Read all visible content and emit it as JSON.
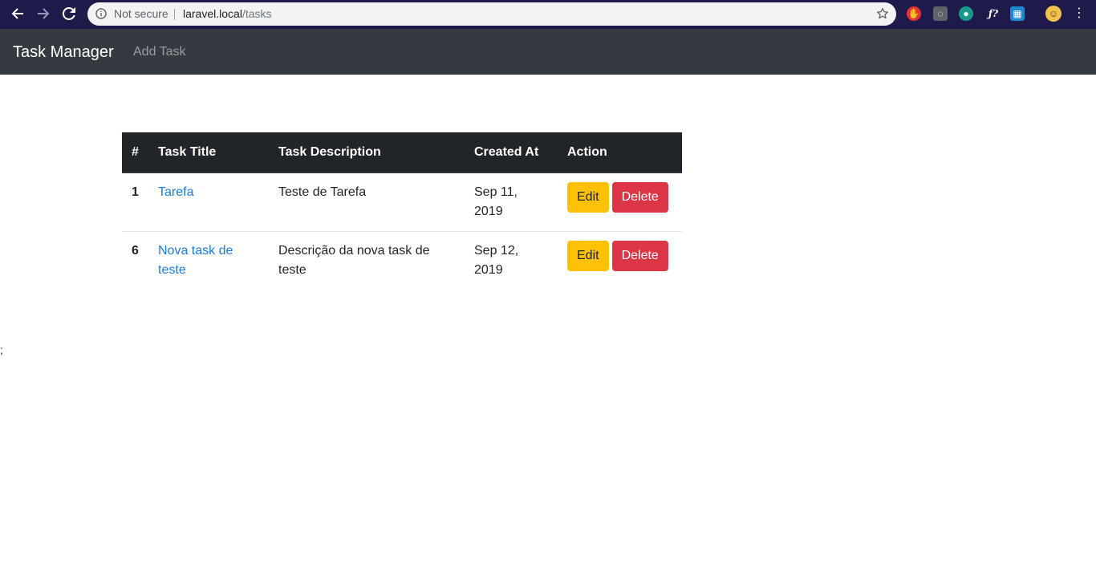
{
  "browser": {
    "security_label": "Not secure",
    "url_host": "laravel.local",
    "url_path": "/tasks",
    "extensions": [
      {
        "name": "adblock-extension-icon",
        "color": "#e8313a",
        "glyph": "✋"
      },
      {
        "name": "lightbulb-extension-icon",
        "color": "#5f6368",
        "glyph": "◌"
      },
      {
        "name": "palette-extension-icon",
        "color": "#1a9b8a",
        "glyph": "●"
      },
      {
        "name": "function-extension-icon",
        "color": "#1e1a4a",
        "glyph": "ƒ?"
      },
      {
        "name": "trello-extension-icon",
        "color": "#1f86d1",
        "glyph": "▦"
      },
      {
        "name": "profile-avatar-icon",
        "color": "#f2c14e",
        "glyph": "☺"
      }
    ]
  },
  "navbar": {
    "brand": "Task Manager",
    "add_task": "Add Task"
  },
  "table": {
    "headers": {
      "id": "#",
      "title": "Task Title",
      "description": "Task Description",
      "created_at": "Created At",
      "action": "Action"
    },
    "rows": [
      {
        "id": "1",
        "title": "Tarefa",
        "description": "Teste de Tarefa",
        "created_at": "Sep 11, 2019",
        "edit": "Edit",
        "delete": "Delete"
      },
      {
        "id": "6",
        "title": "Nova task de teste",
        "description": "Descrição da nova task de teste",
        "created_at": "Sep 12, 2019",
        "edit": "Edit",
        "delete": "Delete"
      }
    ]
  },
  "stray_text": ";"
}
